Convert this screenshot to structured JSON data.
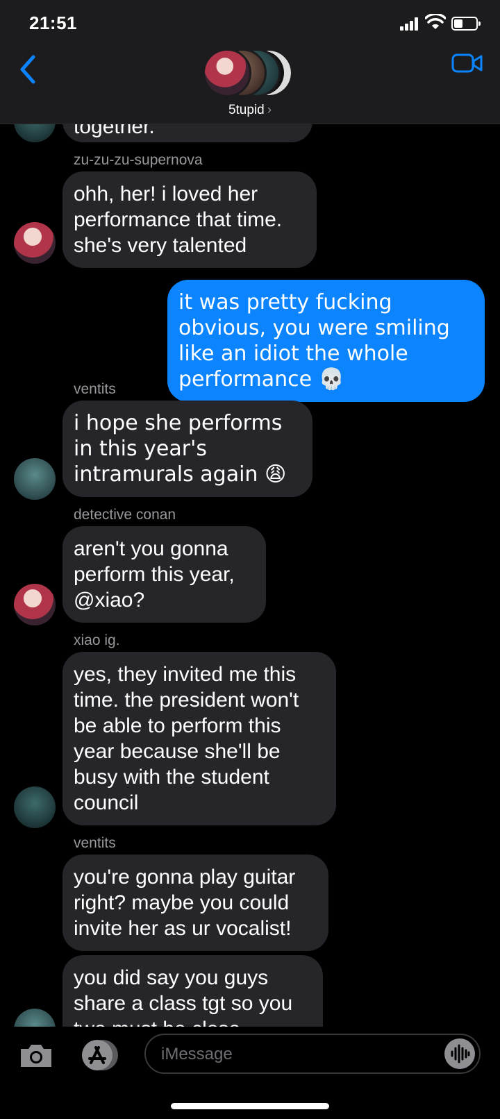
{
  "status_bar": {
    "time": "21:51"
  },
  "header": {
    "group_name": "5tupid",
    "chevron": "›"
  },
  "messages": [
    {
      "sender": "",
      "text": "together."
    },
    {
      "sender": "zu-zu-zu-supernova",
      "text": "ohh, her! i loved her performance that time. she's very talented"
    },
    {
      "sender": "",
      "text": "it was pretty fucking obvious, you were smiling like an idiot the whole performance 💀",
      "outgoing": true
    },
    {
      "sender": "ventits",
      "text": "i hope she performs in this year's intramurals again 😩"
    },
    {
      "sender": "detective conan",
      "text": "aren't you gonna perform this year, @xiao?"
    },
    {
      "sender": "xiao ig.",
      "text": "yes, they invited me this time. the president won't be able to perform this year because she'll be busy with the student council"
    },
    {
      "sender": "ventits",
      "text": "you're gonna play guitar right? maybe you could invite her as ur vocalist!"
    },
    {
      "sender": "",
      "text": "you did say you guys share a class tgt so you two must be close"
    }
  ],
  "input": {
    "placeholder": "iMessage"
  },
  "colors": {
    "accent": "#0b84fe",
    "incoming_bubble": "#26252a",
    "outgoing_bubble": "#0b84fe"
  }
}
